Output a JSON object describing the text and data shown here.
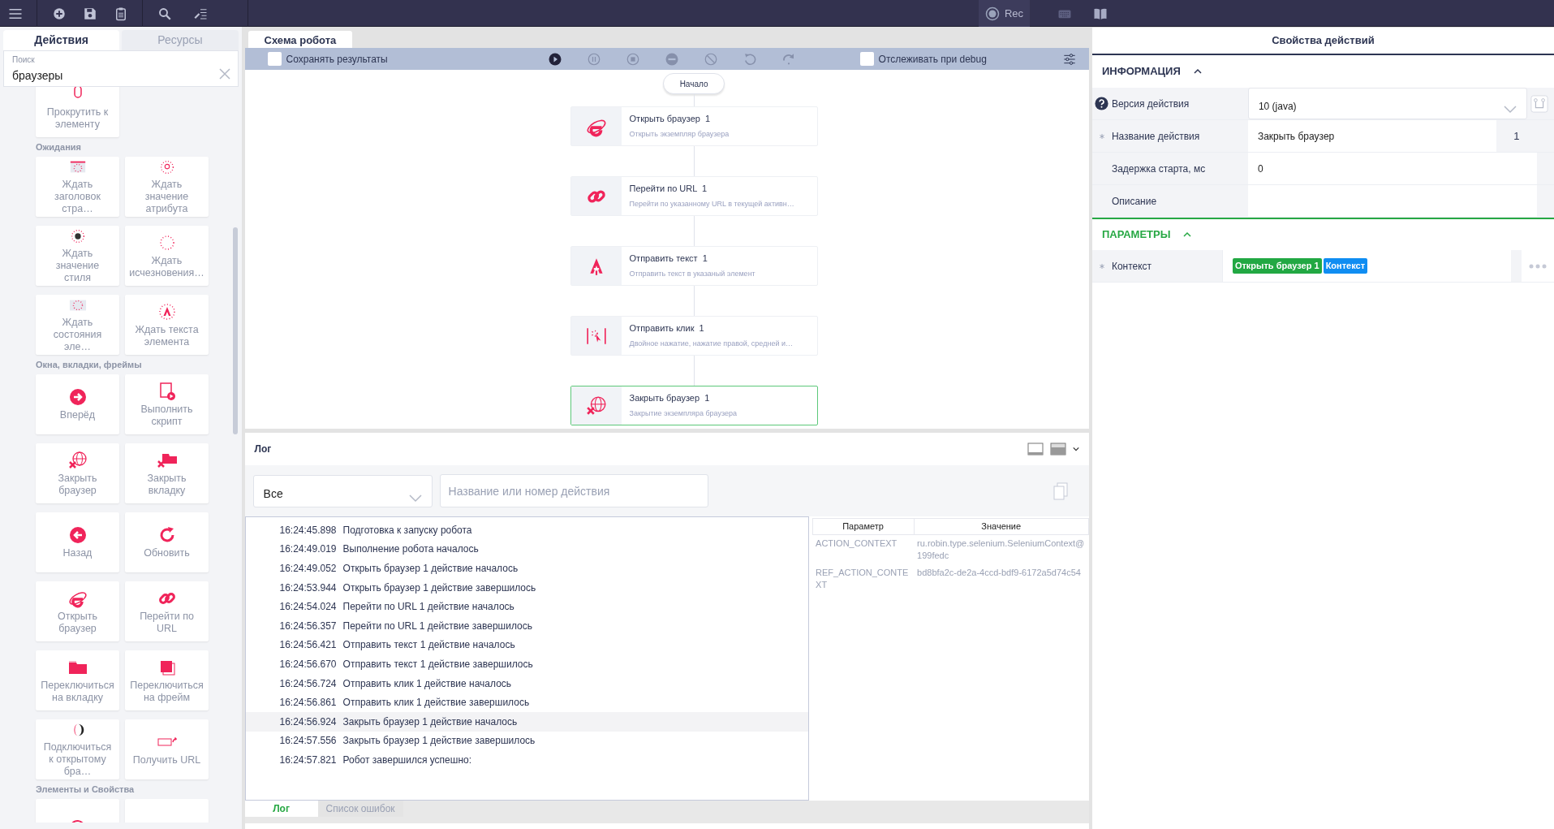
{
  "topbar": {
    "rec": {
      "label": "Rec"
    }
  },
  "palette": {
    "tabs": [
      {
        "label": "Действия",
        "selected": true
      },
      {
        "label": "Ресурсы",
        "selected": false
      }
    ],
    "search": {
      "label": "Поиск",
      "value": "браузеры"
    },
    "sections": [
      {
        "tiles": [
          {
            "kind": "scroll",
            "label": "Прокрутить к элементу"
          }
        ]
      },
      {
        "title": "Ожидания",
        "tiles": [
          {
            "kind": "wait-title",
            "label": "Ждать заголовок стра…"
          },
          {
            "kind": "wait-attr",
            "label": "Ждать значение атрибута"
          },
          {
            "kind": "wait-style",
            "label": "Ждать значение стиля"
          },
          {
            "kind": "wait-vanish",
            "label": "Ждать исчезновения…"
          },
          {
            "kind": "wait-state",
            "label": "Ждать состояния эле…"
          },
          {
            "kind": "wait-text",
            "label": "Ждать текста элемента"
          }
        ]
      },
      {
        "title": "Окна, вкладки, фреймы",
        "tiles": [
          {
            "kind": "forward",
            "label": "Вперёд"
          },
          {
            "kind": "script",
            "label": "Выполнить скрипт"
          },
          {
            "kind": "close-browser",
            "label": "Закрыть браузер"
          },
          {
            "kind": "close-tab",
            "label": "Закрыть вкладку"
          },
          {
            "kind": "back",
            "label": "Назад"
          },
          {
            "kind": "refresh",
            "label": "Обновить"
          },
          {
            "kind": "browser",
            "label": "Открыть браузер"
          },
          {
            "kind": "link",
            "label": "Перейти по URL"
          },
          {
            "kind": "switch-tab",
            "label": "Переключиться на вкладку"
          },
          {
            "kind": "switch-frame",
            "label": "Переключиться на фрейм"
          },
          {
            "kind": "connect",
            "label": "Подключиться к открытому бра…"
          },
          {
            "kind": "get-url",
            "label": "Получить URL"
          }
        ]
      },
      {
        "title": "Элементы и Свойства",
        "tiles": [
          {
            "kind": "info"
          },
          {
            "kind": "id"
          }
        ]
      }
    ]
  },
  "flow": {
    "tab": "Схема робота",
    "save_results": {
      "label": "Сохранять результаты",
      "checked": false
    },
    "controls": [
      {
        "kind": "play",
        "disabled": false
      },
      {
        "kind": "pause",
        "disabled": true
      },
      {
        "kind": "stop",
        "disabled": true
      },
      {
        "kind": "minus",
        "disabled": true
      },
      {
        "kind": "ban",
        "disabled": true
      },
      {
        "kind": "undo",
        "disabled": true
      },
      {
        "kind": "redo",
        "disabled": true
      }
    ],
    "debug": {
      "label": "Отслеживать при debug",
      "checked": false
    },
    "start": "Начало",
    "nodes": [
      {
        "kind": "browser",
        "title": "Открыть браузер",
        "number": "1",
        "description": "Открыть экземпляр браузера",
        "selected": false
      },
      {
        "kind": "link",
        "title": "Перейти по URL",
        "number": "1",
        "description": "Перейти по указанному URL в текущей активн…",
        "selected": false
      },
      {
        "kind": "text",
        "title": "Отправить текст",
        "number": "1",
        "description": "Отправить текст в указаный элемент",
        "selected": false
      },
      {
        "kind": "click",
        "title": "Отправить клик",
        "number": "1",
        "description": "Двойное нажатие, нажатие правой, средней и…",
        "selected": false
      },
      {
        "kind": "close-browser",
        "title": "Закрыть браузер",
        "number": "1",
        "description": "Закрытие экземпляра браузера",
        "selected": true
      }
    ]
  },
  "log": {
    "title": "Лог",
    "filter": {
      "value": "Все"
    },
    "search": {
      "placeholder": "Название или номер действия"
    },
    "entries": [
      {
        "time": "16:24:45.898",
        "message": "Подготовка к запуску робота",
        "selected": false
      },
      {
        "time": "16:24:49.019",
        "message": "Выполнение робота началось",
        "selected": false
      },
      {
        "time": "16:24:49.052",
        "message": "Открыть браузер 1 действие началось",
        "selected": false
      },
      {
        "time": "16:24:53.944",
        "message": "Открыть браузер 1 действие завершилось",
        "selected": false
      },
      {
        "time": "16:24:54.024",
        "message": "Перейти по URL 1 действие началось",
        "selected": false
      },
      {
        "time": "16:24:56.357",
        "message": "Перейти по URL 1 действие завершилось",
        "selected": false
      },
      {
        "time": "16:24:56.421",
        "message": "Отправить текст 1 действие началось",
        "selected": false
      },
      {
        "time": "16:24:56.670",
        "message": "Отправить текст 1 действие завершилось",
        "selected": false
      },
      {
        "time": "16:24:56.724",
        "message": "Отправить клик 1 действие началось",
        "selected": false
      },
      {
        "time": "16:24:56.861",
        "message": "Отправить клик 1 действие завершилось",
        "selected": false
      },
      {
        "time": "16:24:56.924",
        "message": "Закрыть браузер 1 действие началось",
        "selected": true
      },
      {
        "time": "16:24:57.556",
        "message": "Закрыть браузер 1 действие завершилось",
        "selected": false
      },
      {
        "time": "16:24:57.821",
        "message": "Робот завершился успешно:",
        "selected": false
      }
    ],
    "params": {
      "columns": [
        "Параметр",
        "Значение"
      ],
      "rows": [
        [
          "ACTION_CONTEXT",
          "ru.robin.type.selenium.SeleniumContext@199fedc"
        ],
        [
          "REF_ACTION_CONTEXT",
          "bd8bfa2c-de2a-4ccd-bdf9-6172a5d74c54"
        ]
      ]
    },
    "tabs": [
      {
        "label": "Лог",
        "selected": true
      },
      {
        "label": "Список ошибок",
        "selected": false
      }
    ]
  },
  "properties": {
    "title": "Свойства действий",
    "sections": [
      {
        "title": "ИНФОРМАЦИЯ",
        "color": "#2d3552",
        "expanded": true,
        "fields": [
          {
            "kind": "select",
            "label": "Версия действия",
            "value": "10 (java)",
            "help": true,
            "required": false
          },
          {
            "kind": "text",
            "label": "Название действия",
            "value": "Закрыть браузер",
            "counter": "1",
            "help": false,
            "required": true
          },
          {
            "kind": "text",
            "label": "Задержка старта, мс",
            "value": "0",
            "help": false,
            "required": false
          },
          {
            "kind": "textarea",
            "label": "Описание",
            "help": false,
            "required": false
          }
        ]
      },
      {
        "title": "ПАРАМЕТРЫ",
        "color": "#27a844",
        "expanded": true,
        "fields": [
          {
            "kind": "chips",
            "label": "Контекст",
            "help": false,
            "required": true,
            "chips": [
              {
                "text": "Открыть браузер 1",
                "color": "#22a843"
              },
              {
                "text": "Контекст",
                "color": "#0f8df2"
              }
            ]
          }
        ]
      }
    ]
  }
}
